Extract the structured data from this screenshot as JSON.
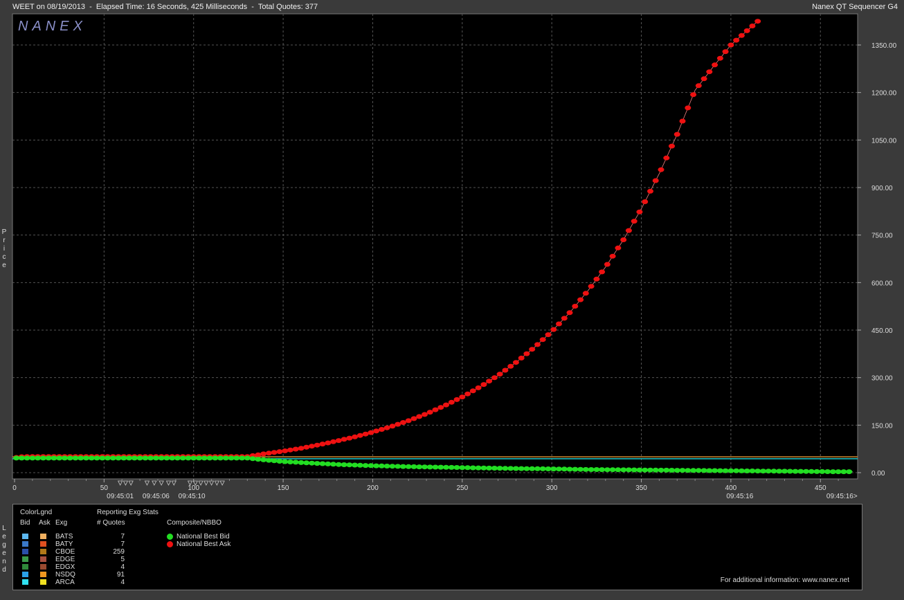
{
  "header": {
    "left": "WEET on 08/19/2013  -  Elapsed Time: 16 Seconds, 425 Milliseconds  -  Total Quotes: 377",
    "right": "Nanex QT Sequencer G4"
  },
  "logo": "NANEX",
  "y_axis_label": "Price",
  "legend_axis_label": "Legend",
  "colors": {
    "bid": "#22dd22",
    "ask": "#ee1111",
    "grid": "#555555"
  },
  "chart_data": {
    "type": "scatter",
    "x_range": [
      0,
      470
    ],
    "y_range": [
      -15,
      1420
    ],
    "x_ticks": [
      0,
      50,
      100,
      150,
      200,
      250,
      300,
      350,
      400,
      450
    ],
    "y_ticks": [
      "0.00",
      "150.00",
      "300.00",
      "450.00",
      "600.00",
      "750.00",
      "900.00",
      "1050.00",
      "1200.00",
      "1350.00"
    ],
    "y_tick_values": [
      0,
      150,
      300,
      450,
      600,
      750,
      900,
      1050,
      1200,
      1350
    ],
    "time_labels": [
      {
        "x": 59,
        "label": "09:45:01"
      },
      {
        "x": 79,
        "label": "09:45:06"
      },
      {
        "x": 99,
        "label": "09:45:10"
      },
      {
        "x": 405,
        "label": "09:45:16"
      },
      {
        "x": 462,
        "label": "09:45:16>"
      }
    ],
    "quote_markers_x": [
      59,
      62,
      65,
      74,
      78,
      82,
      86,
      89,
      98,
      101,
      104,
      107,
      110,
      113,
      116
    ],
    "ref_lines": [
      {
        "name": "orange",
        "color": "#d08a30",
        "y": 50
      },
      {
        "name": "cyan",
        "color": "#22cccc",
        "y": 44
      }
    ],
    "series": [
      {
        "name": "National Best Ask",
        "color": "#ee1111",
        "points": [
          [
            1,
            48
          ],
          [
            5,
            51
          ],
          [
            10,
            51
          ],
          [
            20,
            51
          ],
          [
            30,
            51
          ],
          [
            40,
            51
          ],
          [
            50,
            51
          ],
          [
            60,
            51
          ],
          [
            70,
            51
          ],
          [
            80,
            51
          ],
          [
            90,
            51
          ],
          [
            100,
            51
          ],
          [
            110,
            51
          ],
          [
            120,
            51
          ],
          [
            130,
            51
          ],
          [
            140,
            60
          ],
          [
            150,
            68
          ],
          [
            160,
            77
          ],
          [
            170,
            88
          ],
          [
            180,
            100
          ],
          [
            190,
            113
          ],
          [
            200,
            128
          ],
          [
            210,
            145
          ],
          [
            220,
            164
          ],
          [
            230,
            186
          ],
          [
            240,
            211
          ],
          [
            250,
            239
          ],
          [
            260,
            271
          ],
          [
            270,
            307
          ],
          [
            280,
            348
          ],
          [
            290,
            394
          ],
          [
            300,
            446
          ],
          [
            310,
            505
          ],
          [
            320,
            573
          ],
          [
            330,
            649
          ],
          [
            340,
            735
          ],
          [
            350,
            833
          ],
          [
            360,
            944
          ],
          [
            370,
            1068
          ],
          [
            380,
            1207
          ],
          [
            390,
            1280
          ],
          [
            400,
            1350
          ],
          [
            410,
            1400
          ],
          [
            415,
            1425
          ]
        ]
      },
      {
        "name": "National Best Bid",
        "color": "#22dd22",
        "points": [
          [
            1,
            46
          ],
          [
            5,
            46
          ],
          [
            20,
            46
          ],
          [
            40,
            46
          ],
          [
            60,
            46
          ],
          [
            80,
            46
          ],
          [
            100,
            46
          ],
          [
            120,
            46
          ],
          [
            130,
            46
          ],
          [
            140,
            40
          ],
          [
            150,
            35
          ],
          [
            160,
            32
          ],
          [
            170,
            29
          ],
          [
            180,
            26
          ],
          [
            190,
            24
          ],
          [
            200,
            22
          ],
          [
            220,
            19
          ],
          [
            240,
            17
          ],
          [
            260,
            15
          ],
          [
            280,
            13
          ],
          [
            300,
            12
          ],
          [
            320,
            10
          ],
          [
            340,
            9
          ],
          [
            360,
            8
          ],
          [
            380,
            7
          ],
          [
            400,
            6
          ],
          [
            420,
            5
          ],
          [
            440,
            4
          ],
          [
            460,
            3
          ],
          [
            468,
            3
          ]
        ]
      }
    ]
  },
  "legend": {
    "color_legend_title": "ColorLgnd",
    "bid_header": "Bid",
    "ask_header": "Ask",
    "exg_header": "Exg",
    "stats_title": "Reporting Exg Stats",
    "quotes_header": "# Quotes",
    "composite_title": "Composite/NBBO",
    "rows": [
      {
        "exg": "BATS",
        "quotes": "7",
        "bid": "#5cb8f0",
        "ask": "#f0b060"
      },
      {
        "exg": "BATY",
        "quotes": "7",
        "bid": "#3a78c8",
        "ask": "#e05020"
      },
      {
        "exg": "CBOE",
        "quotes": "259",
        "bid": "#2a4ea8",
        "ask": "#b07818"
      },
      {
        "exg": "EDGE",
        "quotes": "5",
        "bid": "#3a9a48",
        "ask": "#a85040"
      },
      {
        "exg": "EDGX",
        "quotes": "4",
        "bid": "#2f8a3a",
        "ask": "#9a4a30"
      },
      {
        "exg": "NSDQ",
        "quotes": "91",
        "bid": "#2aa0e8",
        "ask": "#f09820"
      },
      {
        "exg": "ARCA",
        "quotes": "4",
        "bid": "#30e0f0",
        "ask": "#f0e020"
      }
    ],
    "nbbo": [
      {
        "label": "National Best Bid",
        "color": "#22dd22"
      },
      {
        "label": "National Best Ask",
        "color": "#ee1111"
      }
    ],
    "footer": "For additional information: www.nanex.net"
  }
}
